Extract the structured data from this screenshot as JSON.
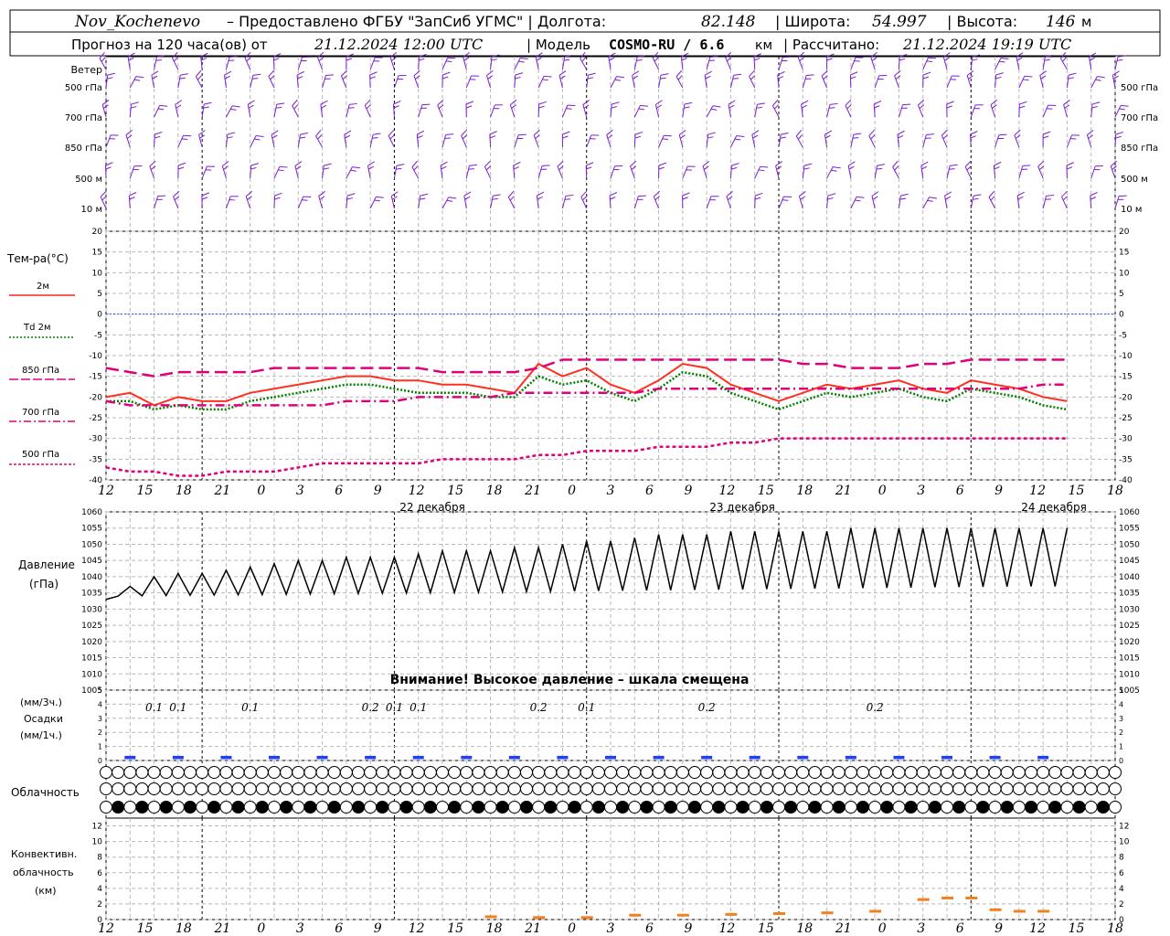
{
  "header": {
    "station": "Nov_Kochenevo",
    "provider": "– Предоставлено ФГБУ \"ЗапСиб УГМС\" | Долгота:",
    "lon": "82.148",
    "lat_label": "| Широта:",
    "lat": "54.997",
    "alt_label": "| Высота:",
    "alt": "146",
    "alt_unit": "м",
    "forecast_prefix": "Прогноз на 120 часа(ов) от",
    "forecast_time": "21.12.2024 12:00 UTC",
    "model_prefix": "| Модель",
    "model": "COSMO-RU / 6.6",
    "model_unit": "км",
    "calc_prefix": "| Рассчитано:",
    "calc_time": "21.12.2024 19:19 UTC"
  },
  "wind_panel": {
    "title": "Ветер",
    "levels": [
      "500 гПа",
      "700 гПа",
      "850 гПа",
      "500 м",
      "10 м"
    ]
  },
  "temp_panel": {
    "title": "Тем-ра(°C)",
    "legend": [
      {
        "label": "2м",
        "color": "#ff2020",
        "dash": "solid"
      },
      {
        "label": "Td 2м",
        "color": "#008000",
        "dash": "dot"
      },
      {
        "label": "850 гПа",
        "color": "#e0007a",
        "dash": "longdash"
      },
      {
        "label": "700 гПа",
        "color": "#e0007a",
        "dash": "dashdot"
      },
      {
        "label": "500 гПа",
        "color": "#e0007a",
        "dash": "shortdash"
      }
    ],
    "yticks": [
      20,
      15,
      10,
      5,
      0,
      -5,
      -10,
      -15,
      -20,
      -25,
      -30,
      -35,
      -40
    ]
  },
  "time_axis": {
    "hours": [
      "12",
      "15",
      "18",
      "21",
      "0",
      "3",
      "6",
      "9",
      "12",
      "15",
      "18",
      "21",
      "0",
      "3",
      "6",
      "9",
      "12",
      "15",
      "18",
      "21",
      "0",
      "3",
      "6",
      "9",
      "12",
      "15",
      "18"
    ],
    "days": [
      "22 декабря",
      "23 декабря",
      "24 декабря"
    ]
  },
  "pressure_panel": {
    "title1": "Давление",
    "title2": "(гПа)",
    "warning": "Внимание! Высокое давление – шкала смещена",
    "yticks": [
      1060,
      1055,
      1050,
      1045,
      1040,
      1035,
      1030,
      1025,
      1020,
      1015,
      1010,
      1005
    ]
  },
  "precip_panel": {
    "title1": "(мм/3ч.)",
    "title2": "Осадки",
    "title3": "(мм/1ч.)",
    "yticks": [
      5,
      4,
      3,
      2,
      1,
      0
    ],
    "labels": [
      "0.1",
      "0.1",
      "0.1",
      "0.2",
      "0.1",
      "0.1",
      "0.2",
      "0.1",
      "0.2",
      "0.2"
    ]
  },
  "cloud_panel": {
    "title": "Облачность"
  },
  "conv_panel": {
    "title1": "Конвективн.",
    "title2": "облачность",
    "title3": "(км)",
    "yticks": [
      12,
      10,
      8,
      6,
      4,
      2,
      0
    ]
  },
  "chart_data": [
    {
      "type": "line",
      "title": "Тем-ра(°C)",
      "ylim": [
        -40,
        20
      ],
      "x_hours_from_start": [
        0,
        3,
        6,
        9,
        12,
        15,
        18,
        21,
        24,
        27,
        30,
        33,
        36,
        39,
        42,
        45,
        48,
        51,
        54,
        57,
        60,
        63,
        66,
        69,
        72,
        75,
        78,
        81,
        84,
        87,
        90,
        93,
        96,
        99,
        102,
        105,
        108,
        111,
        114,
        117,
        120
      ],
      "series": [
        {
          "name": "2м",
          "values": [
            -20,
            -19,
            -22,
            -20,
            -21,
            -21,
            -19,
            -18,
            -17,
            -16,
            -15,
            -15,
            -16,
            -16,
            -17,
            -17,
            -18,
            -19,
            -12,
            -15,
            -13,
            -17,
            -19,
            -16,
            -12,
            -13,
            -17,
            -19,
            -21,
            -19,
            -17,
            -18,
            -17,
            -16,
            -18,
            -19,
            -16,
            -17,
            -18,
            -20,
            -21
          ]
        },
        {
          "name": "Td 2м",
          "values": [
            -21,
            -21,
            -23,
            -22,
            -23,
            -23,
            -21,
            -20,
            -19,
            -18,
            -17,
            -17,
            -18,
            -19,
            -19,
            -19,
            -20,
            -20,
            -15,
            -17,
            -16,
            -19,
            -21,
            -18,
            -14,
            -15,
            -19,
            -21,
            -23,
            -21,
            -19,
            -20,
            -19,
            -18,
            -20,
            -21,
            -18,
            -19,
            -20,
            -22,
            -23
          ]
        },
        {
          "name": "850 гПа",
          "values": [
            -13,
            -14,
            -15,
            -14,
            -14,
            -14,
            -14,
            -13,
            -13,
            -13,
            -13,
            -13,
            -13,
            -13,
            -14,
            -14,
            -14,
            -14,
            -13,
            -11,
            -11,
            -11,
            -11,
            -11,
            -11,
            -11,
            -11,
            -11,
            -11,
            -12,
            -12,
            -13,
            -13,
            -13,
            -12,
            -12,
            -11,
            -11,
            -11,
            -11,
            -11
          ]
        },
        {
          "name": "700 гПа",
          "values": [
            -21,
            -22,
            -22,
            -22,
            -22,
            -22,
            -22,
            -22,
            -22,
            -22,
            -21,
            -21,
            -21,
            -20,
            -20,
            -20,
            -20,
            -19,
            -19,
            -19,
            -19,
            -19,
            -19,
            -18,
            -18,
            -18,
            -18,
            -18,
            -18,
            -18,
            -18,
            -18,
            -18,
            -18,
            -18,
            -18,
            -18,
            -18,
            -18,
            -17,
            -17
          ]
        },
        {
          "name": "500 гПа",
          "values": [
            -37,
            -38,
            -38,
            -39,
            -39,
            -38,
            -38,
            -38,
            -37,
            -36,
            -36,
            -36,
            -36,
            -36,
            -35,
            -35,
            -35,
            -35,
            -34,
            -34,
            -33,
            -33,
            -33,
            -32,
            -32,
            -32,
            -31,
            -31,
            -30,
            -30,
            -30,
            -30,
            -30,
            -30,
            -30,
            -30,
            -30,
            -30,
            -30,
            -30,
            -30
          ]
        }
      ]
    },
    {
      "type": "line",
      "title": "Давление",
      "ylim": [
        1005,
        1060
      ],
      "x_hours_from_start": [
        0,
        3,
        6,
        9,
        12,
        15,
        18,
        21,
        24,
        27,
        30,
        33,
        36,
        39,
        42,
        45,
        48,
        51,
        54,
        57,
        60,
        63,
        66,
        69,
        72,
        75,
        78,
        81,
        84,
        87,
        90,
        93,
        96,
        99,
        102,
        105,
        108,
        111,
        114,
        117,
        120
      ],
      "series": [
        {
          "name": "Давление",
          "values": [
            1033,
            1037,
            1040,
            1041,
            1041,
            1042,
            1043,
            1044,
            1045,
            1045,
            1046,
            1046,
            1046,
            1047,
            1048,
            1048,
            1048,
            1049,
            1049,
            1050,
            1051,
            1051,
            1052,
            1053,
            1053,
            1053,
            1054,
            1054,
            1054,
            1054,
            1054,
            1055,
            1055,
            1055,
            1055,
            1055,
            1055,
            1055,
            1055,
            1055,
            1055
          ]
        }
      ]
    },
    {
      "type": "bar",
      "title": "Осадки",
      "ylim": [
        0,
        5
      ],
      "x_hours_from_start": [
        3,
        9,
        15,
        21,
        27,
        33,
        39,
        45,
        51,
        57,
        63,
        69,
        75,
        81,
        87,
        93,
        99,
        105,
        111,
        117
      ],
      "values": [
        0.2,
        0.2,
        0.2,
        0.2,
        0.2,
        0.2,
        0.2,
        0.2,
        0.2,
        0.2,
        0.2,
        0.2,
        0.2,
        0.2,
        0.2,
        0.2,
        0.2,
        0.2,
        0.2,
        0.2
      ],
      "color": "#1f3fff"
    },
    {
      "type": "bar",
      "title": "Конвективн. облачность",
      "ylim": [
        0,
        13
      ],
      "x_hours_from_start": [
        48,
        54,
        60,
        66,
        72,
        78,
        84,
        90,
        96,
        102,
        105,
        108,
        111,
        114,
        117
      ],
      "values": [
        0.3,
        0.2,
        0.2,
        0.5,
        0.5,
        0.6,
        0.7,
        0.8,
        1.0,
        2.5,
        2.7,
        2.7,
        1.2,
        1.0,
        1.0
      ],
      "color": "#f08020"
    }
  ]
}
